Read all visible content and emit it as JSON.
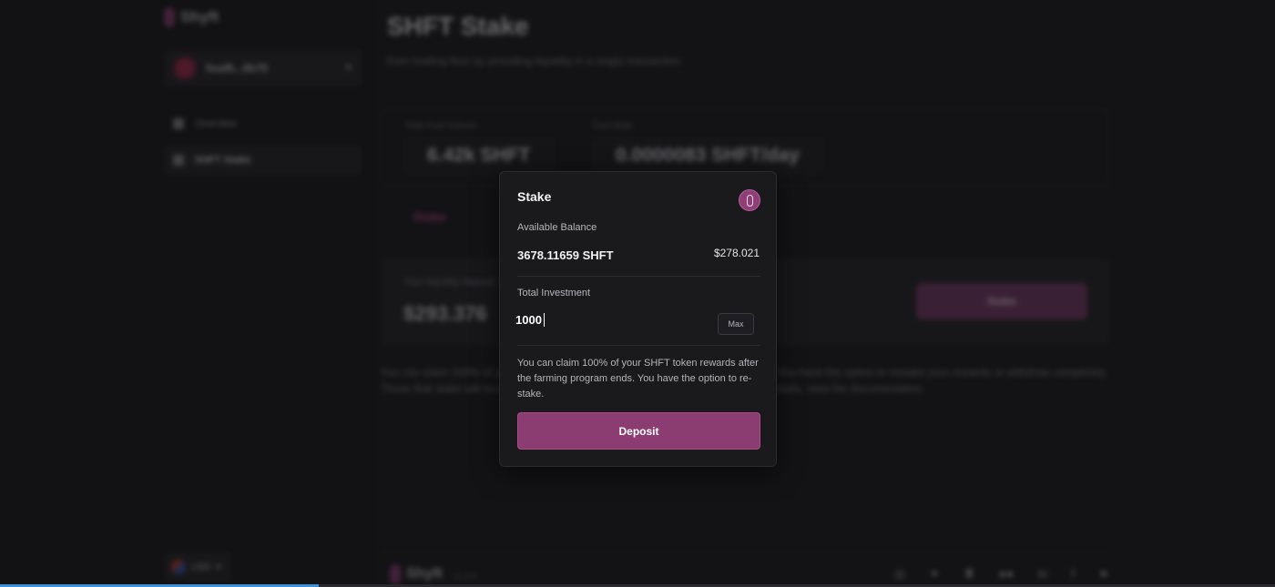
{
  "background": {
    "brand": "Shyft",
    "wallet": {
      "address": "0xaf6...0b70"
    },
    "nav": [
      {
        "label": "Overview"
      },
      {
        "label": "SHFT Stake"
      }
    ],
    "currency": "USD",
    "page_title": "SHFT Stake",
    "page_subtitle": "Earn trading fees by providing liquidity in a single transaction.",
    "stats": [
      {
        "label": "Total Pool Volume",
        "value": "6.42k SHFT"
      },
      {
        "label": "Pool Rate",
        "value": "0.0000083 SHFT/day"
      }
    ],
    "tab": "Stake",
    "deposit": {
      "label": "Your liquidity deposit",
      "value": "$293.376",
      "stake_button": "Stake"
    },
    "info": "You can claim 100% of your SHFT token rewards after the farming program ends. You have the option to restake your rewards or withdraw completely. Those that stake will receive a bigger percentage of token payout. To view more details, view the documentation.",
    "footer": {
      "brand": "Shyft",
      "version": "v1.3.4"
    },
    "socials": [
      "discord-icon",
      "twitter-icon",
      "trophy-icon",
      "medium-icon",
      "linkedin-icon",
      "facebook-icon",
      "telegram-icon"
    ],
    "loading_progress": 0.25
  },
  "modal": {
    "title": "Stake",
    "available_balance_label": "Available Balance",
    "available_balance": "3678.11659 SHFT",
    "available_balance_usd": "$278.021",
    "total_investment_label": "Total Investment",
    "investment_value": "1000",
    "max_label": "Max",
    "info": "You can claim 100% of your SHFT token rewards after the farming program ends. You have the option to re-stake.",
    "deposit_label": "Deposit"
  },
  "colors": {
    "accent": "#8b3d72",
    "background": "#17161a",
    "modal": "#1a191c"
  }
}
